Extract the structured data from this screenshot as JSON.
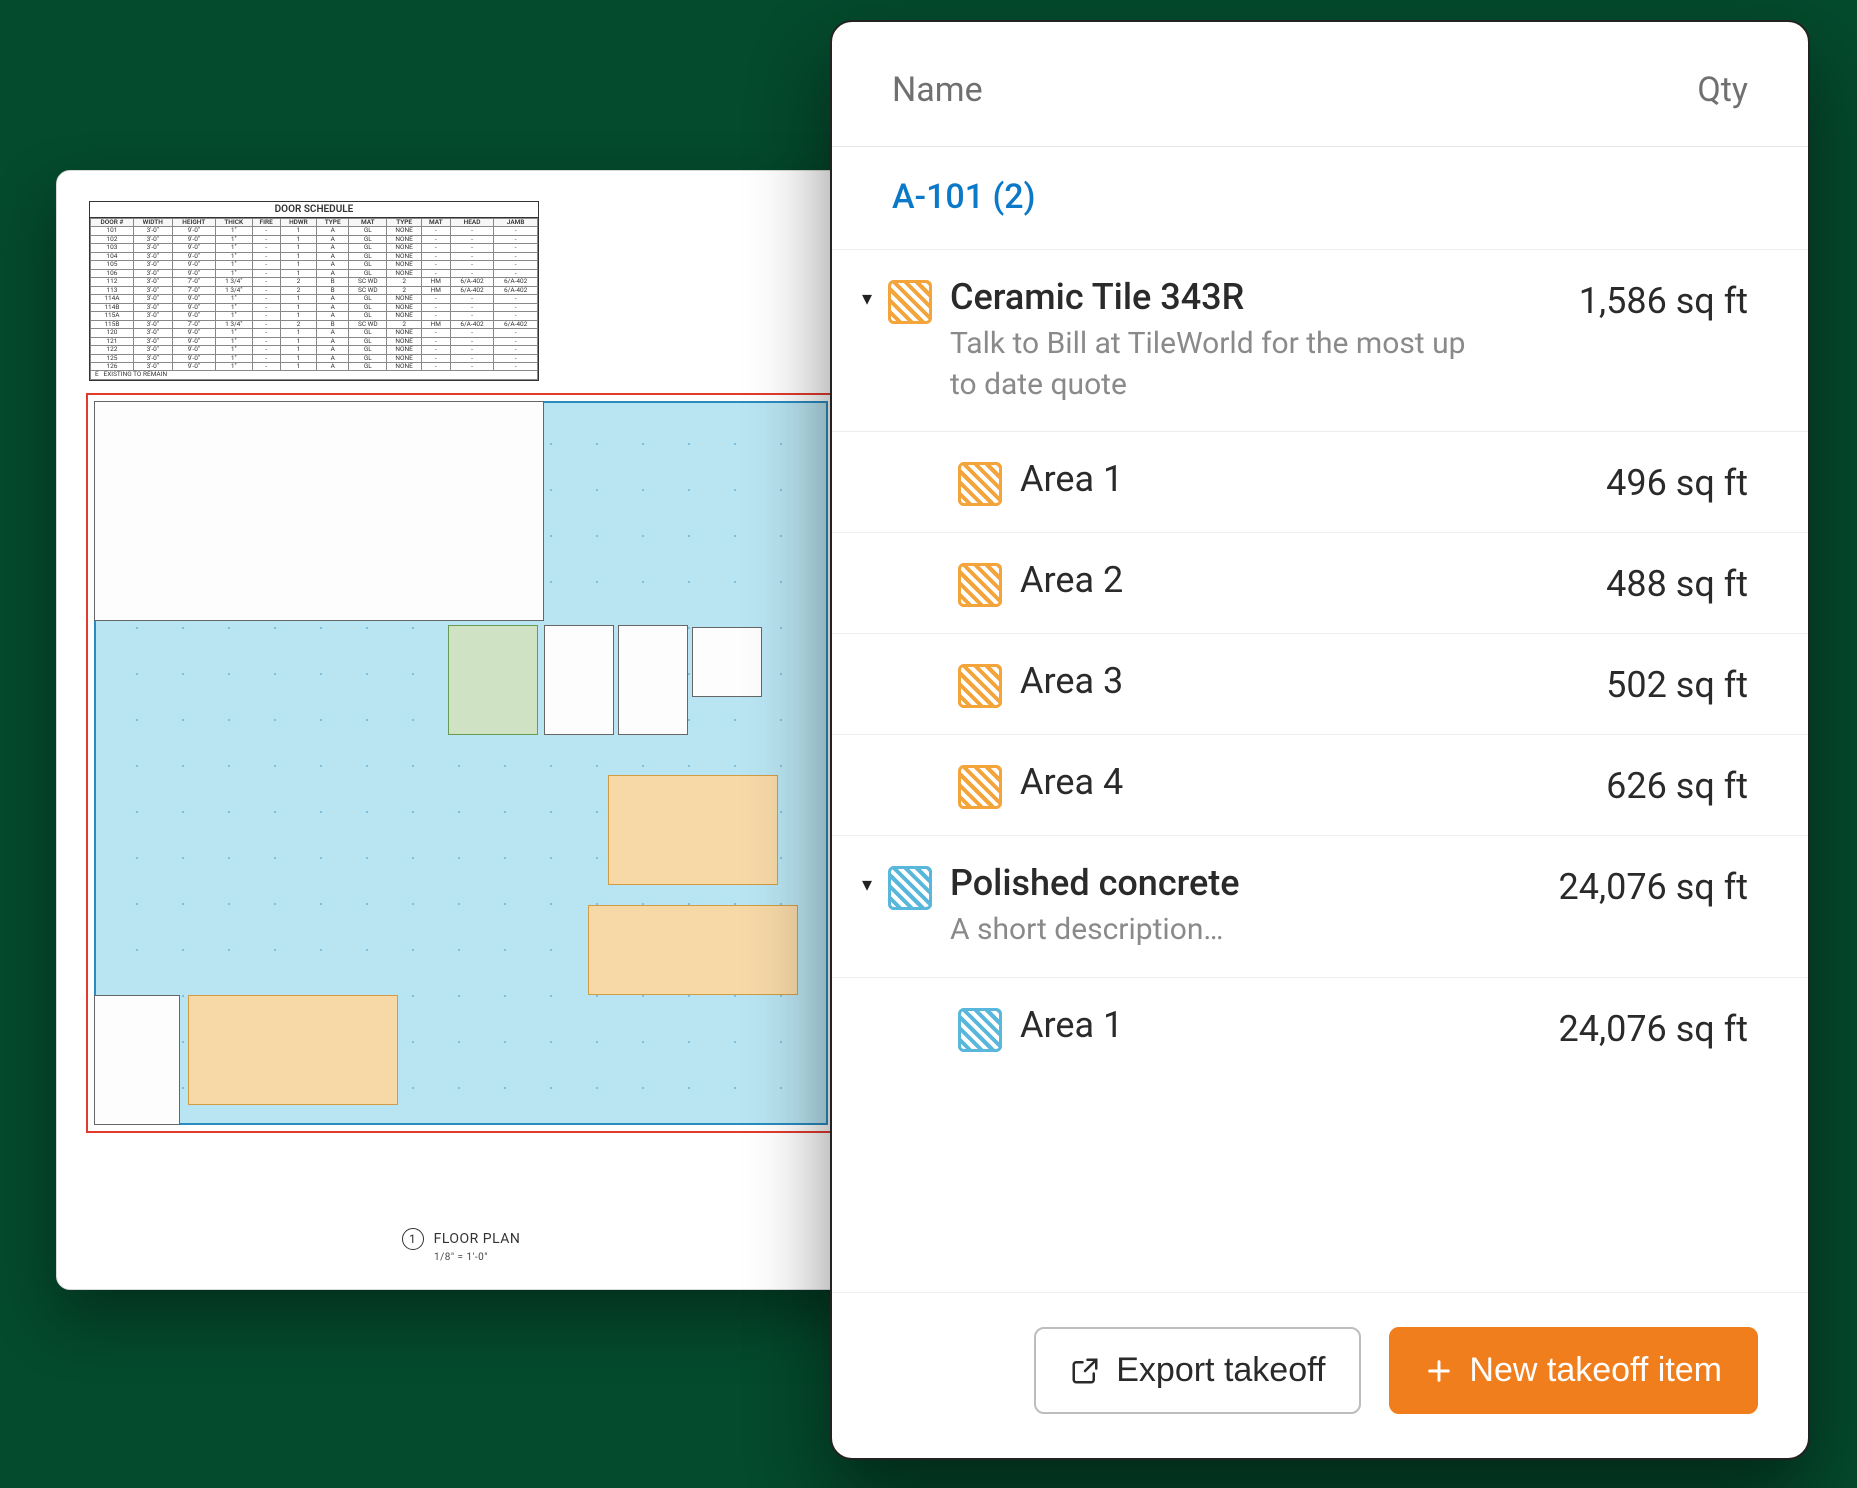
{
  "plan": {
    "schedule_title": "DOOR SCHEDULE",
    "footer_number": "1",
    "footer_title": "FLOOR PLAN",
    "footer_scale": "1/8\" = 1'-0\""
  },
  "panel": {
    "header": {
      "name": "Name",
      "qty": "Qty"
    },
    "sheet_link": "A-101 (2)",
    "items": [
      {
        "swatch": "orange",
        "title": "Ceramic Tile 343R",
        "desc": "Talk to Bill at TileWorld for the most up to date quote",
        "qty": "1,586 sq ft",
        "areas": [
          {
            "title": "Area 1",
            "qty": "496 sq ft"
          },
          {
            "title": "Area 2",
            "qty": "488 sq ft"
          },
          {
            "title": "Area 3",
            "qty": "502 sq ft"
          },
          {
            "title": "Area 4",
            "qty": "626 sq ft"
          }
        ]
      },
      {
        "swatch": "blue",
        "title": "Polished concrete",
        "desc": "A short description…",
        "qty": "24,076 sq ft",
        "areas": [
          {
            "title": "Area 1",
            "qty": "24,076 sq ft"
          }
        ]
      }
    ],
    "buttons": {
      "export": "Export takeoff",
      "new": "New takeoff item"
    }
  }
}
